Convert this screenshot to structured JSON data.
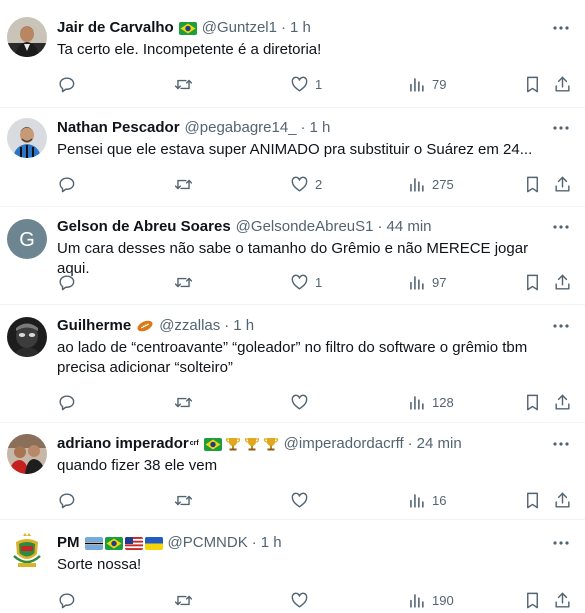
{
  "tweets": [
    {
      "name": "Jair de Carvalho",
      "badge_icons": [
        "brazil-flag-icon"
      ],
      "handle": "@Guntzel1",
      "separator": "·",
      "time": "1 h",
      "text": "Ta certo ele. Incompetente é a diretoria!",
      "replies": "",
      "retweets": "",
      "likes": "1",
      "views": "79",
      "avatar_icon": "man-in-suit-avatar"
    },
    {
      "name": "Nathan Pescador",
      "badge_icons": [],
      "handle": "@pegabagre14_",
      "separator": "·",
      "time": "1 h",
      "text": "Pensei que ele estava super ANIMADO pra substituir o Suárez em 24...",
      "replies": "",
      "retweets": "",
      "likes": "2",
      "views": "275",
      "avatar_icon": "man-in-blue-jersey-avatar"
    },
    {
      "name": "Gelson de Abreu Soares",
      "badge_icons": [],
      "handle": "@GelsondeAbreuS1",
      "separator": "·",
      "time": "44 min",
      "text": "Um cara desses não sabe o tamanho do Grêmio e não MERECE jogar aqui.",
      "replies": "",
      "retweets": "",
      "likes": "1",
      "views": "97",
      "avatar_letter": "G",
      "avatar_color": "#6d8591"
    },
    {
      "name": "Guilherme",
      "badge_icons": [
        "football-icon"
      ],
      "handle": "@zzallas",
      "separator": "·",
      "time": "1 h",
      "text": "ao lado de “centroavante” “goleador” no filtro do software o grêmio tbm\nprecisa adicionar “solteiro”",
      "replies": "",
      "retweets": "",
      "likes": "",
      "views": "128",
      "avatar_icon": "dark-masked-avatar"
    },
    {
      "name": "adriano imperador",
      "name_sup": "crf",
      "badge_icons": [
        "brazil-flag-icon",
        "trophy-icon",
        "trophy-icon",
        "trophy-icon"
      ],
      "handle": "@imperadordacrff",
      "separator": "·",
      "time": "24 min",
      "text": "quando fizer 38 ele vem",
      "replies": "",
      "retweets": "",
      "likes": "",
      "views": "16",
      "avatar_icon": "group-photo-avatar"
    },
    {
      "name": "PM",
      "badge_icons": [
        "botswana-flag-icon",
        "brazil-flag-icon",
        "usa-flag-icon",
        "ukraine-flag-icon"
      ],
      "handle": "@PCMNDK",
      "separator": "·",
      "time": "1 h",
      "text": "Sorte nossa!",
      "replies": "",
      "retweets": "",
      "likes": "",
      "views": "190",
      "avatar_icon": "coat-of-arms-avatar"
    }
  ],
  "icons": {
    "reply": "reply-icon",
    "retweet": "retweet-icon",
    "like": "heart-icon",
    "views": "views-icon",
    "bookmark": "bookmark-icon",
    "share": "share-icon",
    "more": "more-icon"
  },
  "colors": {
    "text": "#0f1419",
    "secondary": "#536471",
    "divider": "#eff3f4"
  }
}
